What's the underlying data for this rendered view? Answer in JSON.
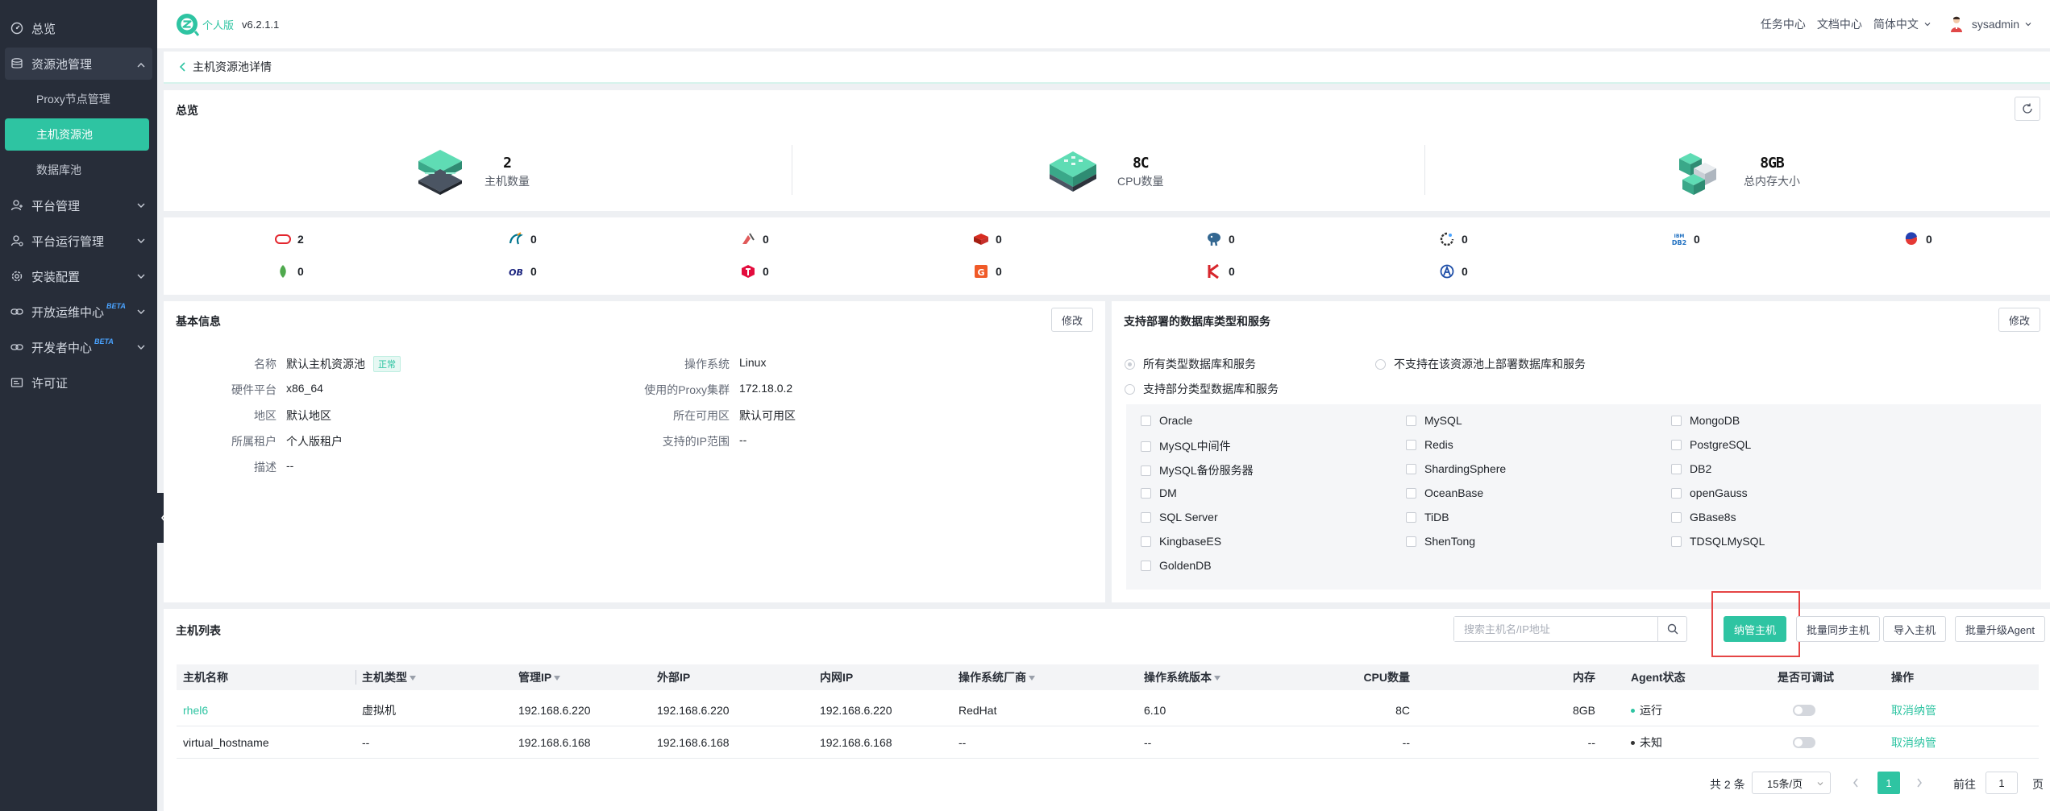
{
  "app": {
    "edition": "个人版",
    "version": "v6.2.1.1"
  },
  "header": {
    "task_center": "任务中心",
    "docs_center": "文档中心",
    "language": "简体中文",
    "user": "sysadmin"
  },
  "sidebar": {
    "overview": "总览",
    "resource_pool": "资源池管理",
    "proxy_nodes": "Proxy节点管理",
    "host_pool": "主机资源池",
    "db_pool": "数据库池",
    "platform_mgmt": "平台管理",
    "platform_ops": "平台运行管理",
    "install_config": "安装配置",
    "open_ops_center": "开放运维中心",
    "dev_center": "开发者中心",
    "beta": "BETA",
    "license": "许可证"
  },
  "page": {
    "title": "主机资源池详情"
  },
  "overview": {
    "title": "总览",
    "host_count": "2",
    "host_label": "主机数量",
    "cpu_count": "8C",
    "cpu_label": "CPU数量",
    "mem_total": "8GB",
    "mem_label": "总内存大小"
  },
  "db_counts": [
    "2",
    "0",
    "0",
    "0",
    "0",
    "0",
    "0",
    "0",
    "0",
    "0",
    "0",
    "0",
    "0",
    "0"
  ],
  "basic_info": {
    "title": "基本信息",
    "edit": "修改",
    "name_k": "名称",
    "name_v": "默认主机资源池",
    "status": "正常",
    "hw_k": "硬件平台",
    "hw_v": "x86_64",
    "region_k": "地区",
    "region_v": "默认地区",
    "tenant_k": "所属租户",
    "tenant_v": "个人版租户",
    "desc_k": "描述",
    "desc_v": "--",
    "os_k": "操作系统",
    "os_v": "Linux",
    "proxy_k": "使用的Proxy集群",
    "proxy_v": "172.18.0.2",
    "az_k": "所在可用区",
    "az_v": "默认可用区",
    "ip_k": "支持的IP范围",
    "ip_v": "--"
  },
  "support": {
    "title": "支持部署的数据库类型和服务",
    "edit": "修改",
    "opt_all": "所有类型数据库和服务",
    "opt_none": "不支持在该资源池上部署数据库和服务",
    "opt_part": "支持部分类型数据库和服务",
    "dbs": [
      "Oracle",
      "MySQL",
      "MongoDB",
      "MySQL中间件",
      "Redis",
      "PostgreSQL",
      "MySQL备份服务器",
      "ShardingSphere",
      "DB2",
      "DM",
      "OceanBase",
      "openGauss",
      "SQL Server",
      "TiDB",
      "GBase8s",
      "KingbaseES",
      "ShenTong",
      "TDSQLMySQL",
      "GoldenDB"
    ]
  },
  "host_list": {
    "title": "主机列表",
    "search_placeholder": "搜索主机名/IP地址",
    "btn_manage": "纳管主机",
    "btn_sync": "批量同步主机",
    "btn_import": "导入主机",
    "btn_upgrade": "批量升级Agent",
    "columns": [
      "主机名称",
      "主机类型",
      "管理IP",
      "外部IP",
      "内网IP",
      "操作系统厂商",
      "操作系统版本",
      "CPU数量",
      "内存",
      "Agent状态",
      "是否可调试",
      "操作"
    ],
    "rows": [
      {
        "name": "rhel6",
        "type": "虚拟机",
        "mgmt_ip": "192.168.6.220",
        "ext_ip": "192.168.6.220",
        "int_ip": "192.168.6.220",
        "vendor": "RedHat",
        "os_ver": "6.10",
        "cpu": "8C",
        "mem": "8GB",
        "agent": "运行",
        "action": "取消纳管"
      },
      {
        "name": "virtual_hostname",
        "type": "--",
        "mgmt_ip": "192.168.6.168",
        "ext_ip": "192.168.6.168",
        "int_ip": "192.168.6.168",
        "vendor": "--",
        "os_ver": "--",
        "cpu": "--",
        "mem": "--",
        "agent": "未知",
        "action": "取消纳管"
      }
    ],
    "total": "共 2 条",
    "page_size": "15条/页",
    "page": "1",
    "goto": "前往",
    "goto_value": "1",
    "page_unit": "页"
  },
  "colors": {
    "accent": "#2ec4a2",
    "sidebar": "#272d39",
    "highlight_box": "#e54545",
    "agent_running": "#2ec4a2",
    "agent_unknown": "#333333"
  }
}
